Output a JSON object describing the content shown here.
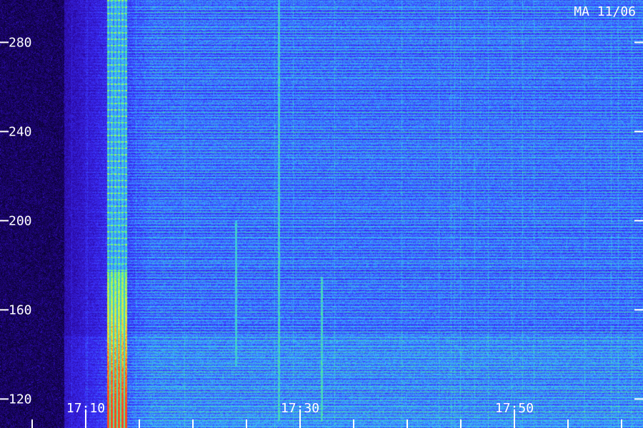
{
  "chart_data": {
    "type": "heatmap",
    "title": "",
    "corner_label": "MA 11/06",
    "xlabel": "",
    "ylabel": "",
    "x_ticks": [
      "17:10",
      "17:30",
      "17:50"
    ],
    "x_range": [
      "17:02",
      "18:02"
    ],
    "minor_tick_interval_minutes": 5,
    "y_ticks": [
      120,
      160,
      200,
      240,
      280
    ],
    "ylim": [
      107,
      299
    ],
    "grid": false,
    "colormap": [
      "#04001a",
      "#2a08a0",
      "#3b30ff",
      "#39b8ff",
      "#4ef08a",
      "#e6f53a",
      "#ff4a1a"
    ],
    "events": [
      {
        "name": "broadband burst",
        "time_start": "17:12",
        "time_end": "17:13",
        "freq_range": [
          110,
          299
        ],
        "peak_intensity": 1.0
      },
      {
        "name": "narrow drift line",
        "time": "17:24",
        "freq_range": [
          135,
          200
        ],
        "peak_intensity": 0.5
      },
      {
        "name": "narrow line",
        "time": "17:28",
        "freq_range": [
          110,
          299
        ],
        "peak_intensity": 0.6
      },
      {
        "name": "narrow line",
        "time": "17:32",
        "freq_range": [
          110,
          175
        ],
        "peak_intensity": 0.6
      }
    ]
  }
}
